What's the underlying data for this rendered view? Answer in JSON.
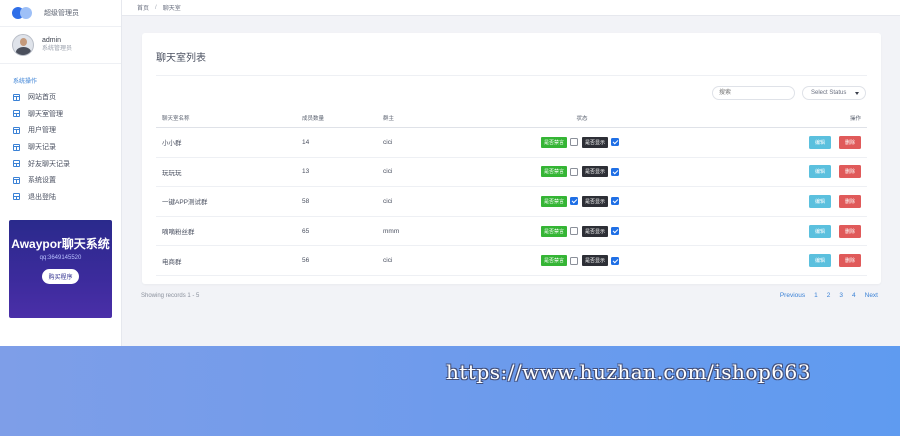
{
  "app": {
    "title": "超级管理员"
  },
  "user": {
    "name": "admin",
    "role": "系统管理员"
  },
  "sidebar": {
    "section_label": "系统操作",
    "items": [
      {
        "label": "网站首页",
        "icon": "layout-icon"
      },
      {
        "label": "聊天室管理",
        "icon": "layout-icon"
      },
      {
        "label": "用户管理",
        "icon": "layout-icon"
      },
      {
        "label": "聊天记录",
        "icon": "layout-icon"
      },
      {
        "label": "好友聊天记录",
        "icon": "layout-icon"
      },
      {
        "label": "系统设置",
        "icon": "layout-icon"
      },
      {
        "label": "退出登陆",
        "icon": "layout-icon"
      }
    ]
  },
  "promo": {
    "title": "Awaypor聊天系统",
    "qq": "qq:3649145520",
    "button": "购买程序"
  },
  "breadcrumb": {
    "home": "首页",
    "separator": "/",
    "current": "聊天室"
  },
  "card": {
    "title": "聊天室列表",
    "search_placeholder": "搜索",
    "status_select": "Select Status"
  },
  "table": {
    "headers": {
      "name": "聊天室名称",
      "members": "成员数量",
      "owner": "群主",
      "status": "状态",
      "ops": "操作"
    },
    "rows": [
      {
        "name": "小小群",
        "members": "14",
        "owner": "cici",
        "badge1": "是否禁言",
        "mute": false,
        "badge2": "是否显示",
        "show": true,
        "edit": "编辑",
        "del": "删除"
      },
      {
        "name": "玩玩玩",
        "members": "13",
        "owner": "cici",
        "badge1": "是否禁言",
        "mute": false,
        "badge2": "是否显示",
        "show": true,
        "edit": "编辑",
        "del": "删除"
      },
      {
        "name": "一键APP测试群",
        "members": "58",
        "owner": "cici",
        "badge1": "是否禁言",
        "mute": true,
        "badge2": "是否显示",
        "show": true,
        "edit": "编辑",
        "del": "删除"
      },
      {
        "name": "嘀嘀粉丝群",
        "members": "65",
        "owner": "mmm",
        "badge1": "是否禁言",
        "mute": false,
        "badge2": "是否显示",
        "show": true,
        "edit": "编辑",
        "del": "删除"
      },
      {
        "name": "电商群",
        "members": "56",
        "owner": "cici",
        "badge1": "是否禁言",
        "mute": false,
        "badge2": "是否显示",
        "show": true,
        "edit": "编辑",
        "del": "删除"
      }
    ]
  },
  "footer": {
    "showing": "Showing records 1 - 5",
    "pagination": {
      "prev": "Previous",
      "pages": [
        "1",
        "2",
        "3",
        "4"
      ],
      "next": "Next"
    }
  },
  "banner": {
    "text": "https://www.huzhan.com/ishop663"
  },
  "colors": {
    "accent": "#3b82d6",
    "badge_green": "#35b535",
    "badge_dark": "#2d2f36",
    "edit_button": "#5bc0de",
    "delete_button": "#e05a5a",
    "checkbox_checked": "#1f6fe5"
  }
}
